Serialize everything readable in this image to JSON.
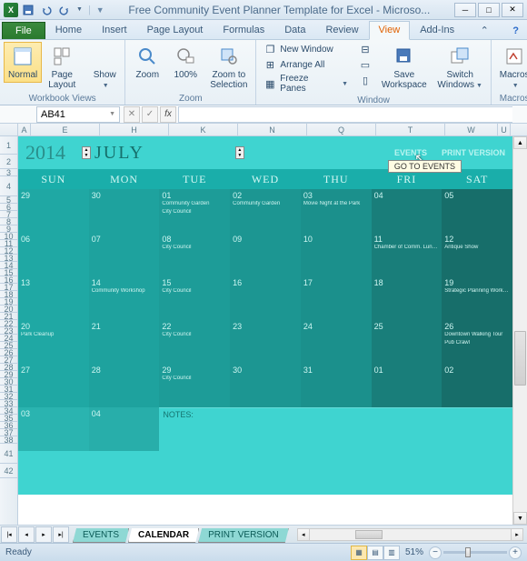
{
  "titlebar": {
    "title": "Free Community Event Planner Template for Excel - Microso..."
  },
  "ribbon_tabs": {
    "file": "File",
    "items": [
      "Home",
      "Insert",
      "Page Layout",
      "Formulas",
      "Data",
      "Review",
      "View",
      "Add-Ins"
    ],
    "active": "View"
  },
  "ribbon": {
    "views_group": "Workbook Views",
    "normal": "Normal",
    "page_layout": "Page\nLayout",
    "show": "Show",
    "zoom_group": "Zoom",
    "zoom": "Zoom",
    "zoom_100": "100%",
    "zoom_sel": "Zoom to\nSelection",
    "window_group": "Window",
    "new_window": "New Window",
    "arrange_all": "Arrange All",
    "freeze_panes": "Freeze Panes",
    "save_workspace": "Save\nWorkspace",
    "switch_windows": "Switch\nWindows",
    "macros_group": "Macros",
    "macros": "Macros"
  },
  "namebox": "AB41",
  "fx_label": "fx",
  "col_headers": [
    "A",
    "E",
    "H",
    "K",
    "N",
    "Q",
    "T",
    "W",
    "U"
  ],
  "row_headers": [
    "1",
    "2",
    "3",
    "4",
    "5",
    "6",
    "7",
    "8",
    "9",
    "10",
    "11",
    "12",
    "13",
    "14",
    "15",
    "16",
    "17",
    "18",
    "19",
    "20",
    "21",
    "22",
    "23",
    "24",
    "25",
    "26",
    "27",
    "28",
    "29",
    "30",
    "31",
    "32",
    "33",
    "34",
    "35",
    "36",
    "37",
    "38",
    "41",
    "42"
  ],
  "calendar": {
    "year": "2014",
    "month": "JULY",
    "events_link": "EVENTS",
    "print_link": "PRINT VERSION",
    "tooltip": "GO TO EVENTS",
    "dow": [
      "SUN",
      "MON",
      "TUE",
      "WED",
      "THU",
      "FRI",
      "SAT"
    ],
    "weeks": [
      [
        {
          "d": "29",
          "e": []
        },
        {
          "d": "30",
          "e": []
        },
        {
          "d": "01",
          "e": [
            "Community Garden",
            "City Council"
          ]
        },
        {
          "d": "02",
          "e": [
            "Community Garden"
          ]
        },
        {
          "d": "03",
          "e": [
            "Movie Night at the Park"
          ]
        },
        {
          "d": "04",
          "e": []
        },
        {
          "d": "05",
          "e": []
        }
      ],
      [
        {
          "d": "06",
          "e": []
        },
        {
          "d": "07",
          "e": []
        },
        {
          "d": "08",
          "e": [
            "City Council"
          ]
        },
        {
          "d": "09",
          "e": []
        },
        {
          "d": "10",
          "e": []
        },
        {
          "d": "11",
          "e": [
            "Chamber of Comm. Luncheon"
          ]
        },
        {
          "d": "12",
          "e": [
            "Antique Show"
          ]
        }
      ],
      [
        {
          "d": "13",
          "e": []
        },
        {
          "d": "14",
          "e": [
            "Community Workshop"
          ]
        },
        {
          "d": "15",
          "e": [
            "City Council"
          ]
        },
        {
          "d": "16",
          "e": []
        },
        {
          "d": "17",
          "e": []
        },
        {
          "d": "18",
          "e": []
        },
        {
          "d": "19",
          "e": [
            "Strategic Planning Workshop"
          ]
        }
      ],
      [
        {
          "d": "20",
          "e": [
            "Park Cleanup"
          ]
        },
        {
          "d": "21",
          "e": []
        },
        {
          "d": "22",
          "e": [
            "City Council"
          ]
        },
        {
          "d": "23",
          "e": []
        },
        {
          "d": "24",
          "e": []
        },
        {
          "d": "25",
          "e": []
        },
        {
          "d": "26",
          "e": [
            "Downtown Walking Tour",
            "Pub Crawl"
          ]
        }
      ],
      [
        {
          "d": "27",
          "e": []
        },
        {
          "d": "28",
          "e": []
        },
        {
          "d": "29",
          "e": [
            "City Council"
          ]
        },
        {
          "d": "30",
          "e": []
        },
        {
          "d": "31",
          "e": []
        },
        {
          "d": "01",
          "e": []
        },
        {
          "d": "02",
          "e": []
        }
      ]
    ],
    "extra": [
      "03",
      "04"
    ],
    "notes_label": "NOTES:"
  },
  "sheet_tabs": {
    "items": [
      "EVENTS",
      "CALENDAR",
      "PRINT VERSION"
    ],
    "active": "CALENDAR"
  },
  "status": {
    "ready": "Ready",
    "zoom": "51%"
  }
}
